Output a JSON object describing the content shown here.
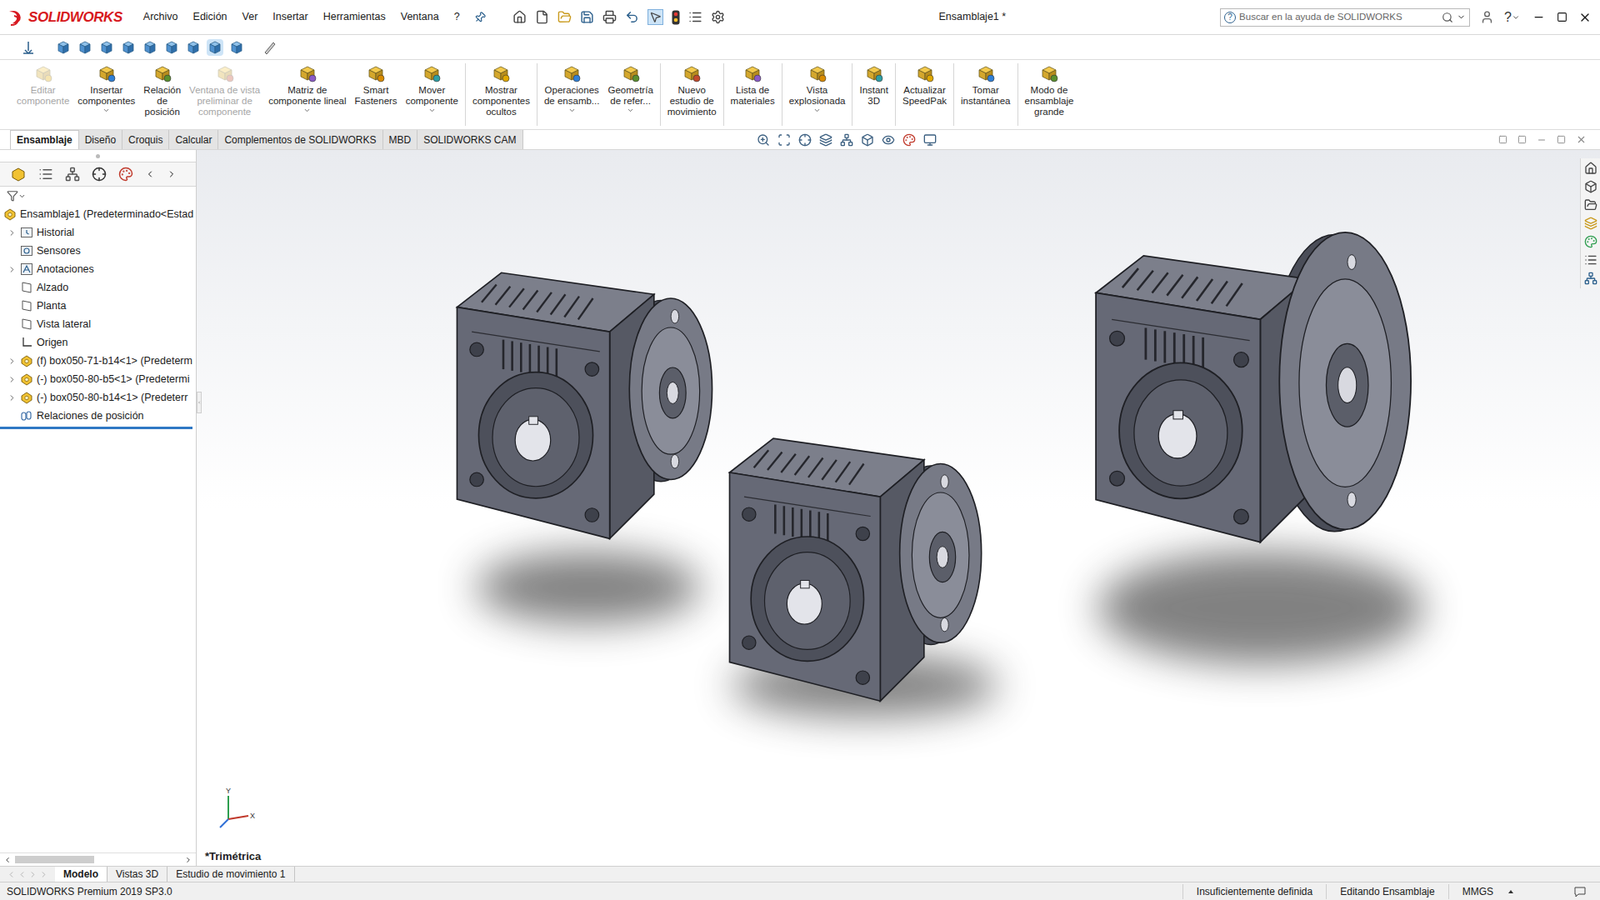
{
  "window": {
    "title": "Ensamblaje1 *",
    "logo": "SOLIDWORKS"
  },
  "menu": [
    "Archivo",
    "Edición",
    "Ver",
    "Insertar",
    "Herramientas",
    "Ventana",
    "?"
  ],
  "search": {
    "placeholder": "Buscar en la ayuda de SOLIDWORKS"
  },
  "help": "?",
  "ribbon": {
    "groups": [
      [
        {
          "label": [
            "Editar",
            "componente"
          ],
          "disabled": true,
          "dropdown": false
        },
        {
          "label": [
            "Insertar",
            "componentes"
          ],
          "disabled": false,
          "dropdown": true
        },
        {
          "label": [
            "Relación",
            "de",
            "posición"
          ],
          "disabled": false,
          "dropdown": false
        },
        {
          "label": [
            "Ventana de vista",
            "preliminar de",
            "componente"
          ],
          "disabled": true,
          "dropdown": false
        },
        {
          "label": [
            "Matriz de",
            "componente lineal"
          ],
          "disabled": false,
          "dropdown": true
        },
        {
          "label": [
            "Smart",
            "Fasteners"
          ],
          "disabled": false,
          "dropdown": false
        },
        {
          "label": [
            "Mover",
            "componente"
          ],
          "disabled": false,
          "dropdown": true
        }
      ],
      [
        {
          "label": [
            "Mostrar",
            "componentes",
            "ocultos"
          ],
          "disabled": false,
          "dropdown": false
        }
      ],
      [
        {
          "label": [
            "Operaciones",
            "de ensamb..."
          ],
          "disabled": false,
          "dropdown": true
        },
        {
          "label": [
            "Geometría",
            "de refer..."
          ],
          "disabled": false,
          "dropdown": true
        }
      ],
      [
        {
          "label": [
            "Nuevo",
            "estudio de",
            "movimiento"
          ],
          "disabled": false,
          "dropdown": false
        }
      ],
      [
        {
          "label": [
            "Lista de",
            "materiales"
          ],
          "disabled": false,
          "dropdown": false
        }
      ],
      [
        {
          "label": [
            "Vista",
            "explosionada"
          ],
          "disabled": false,
          "dropdown": true
        }
      ],
      [
        {
          "label": [
            "Instant",
            "3D"
          ],
          "disabled": false,
          "dropdown": false
        }
      ],
      [
        {
          "label": [
            "Actualizar",
            "SpeedPak"
          ],
          "disabled": false,
          "dropdown": false
        }
      ],
      [
        {
          "label": [
            "Tomar",
            "instantánea"
          ],
          "disabled": false,
          "dropdown": false
        }
      ],
      [
        {
          "label": [
            "Modo de",
            "ensamblaje",
            "grande"
          ],
          "disabled": false,
          "dropdown": false
        }
      ]
    ]
  },
  "tabs": [
    {
      "label": "Ensamblaje",
      "selected": true
    },
    {
      "label": "Diseño",
      "selected": false
    },
    {
      "label": "Croquis",
      "selected": false
    },
    {
      "label": "Calcular",
      "selected": false
    },
    {
      "label": "Complementos de SOLIDWORKS",
      "selected": false
    },
    {
      "label": "MBD",
      "selected": false
    },
    {
      "label": "SOLIDWORKS CAM",
      "selected": false
    }
  ],
  "tree": {
    "root": "Ensamblaje1  (Predeterminado<Estad",
    "items": [
      {
        "label": "Historial",
        "kind": "history",
        "expandable": true
      },
      {
        "label": "Sensores",
        "kind": "sensors",
        "expandable": false
      },
      {
        "label": "Anotaciones",
        "kind": "annotations",
        "expandable": true
      },
      {
        "label": "Alzado",
        "kind": "plane",
        "expandable": false
      },
      {
        "label": "Planta",
        "kind": "plane",
        "expandable": false
      },
      {
        "label": "Vista lateral",
        "kind": "plane",
        "expandable": false
      },
      {
        "label": "Origen",
        "kind": "origin",
        "expandable": false
      },
      {
        "label": "(f) box050-71-b14<1> (Predeterm",
        "kind": "part",
        "expandable": true
      },
      {
        "label": "(-) box050-80-b5<1> (Predetermi",
        "kind": "part",
        "expandable": true
      },
      {
        "label": "(-) box050-80-b14<1> (Predeterr",
        "kind": "part",
        "expandable": true
      },
      {
        "label": "Relaciones de posición",
        "kind": "mates",
        "expandable": false
      }
    ]
  },
  "viewport": {
    "view_label": "*Trimétrica",
    "triad": {
      "x": "X",
      "y": "Y"
    }
  },
  "bottom_tabs": [
    {
      "label": "Modelo",
      "selected": true
    },
    {
      "label": "Vistas 3D",
      "selected": false
    },
    {
      "label": "Estudio de movimiento 1",
      "selected": false
    }
  ],
  "status_bar": {
    "product": "SOLIDWORKS Premium 2019 SP3.0",
    "items": [
      "Insuficientemente definida",
      "Editando Ensamblaje",
      "MMGS"
    ]
  }
}
